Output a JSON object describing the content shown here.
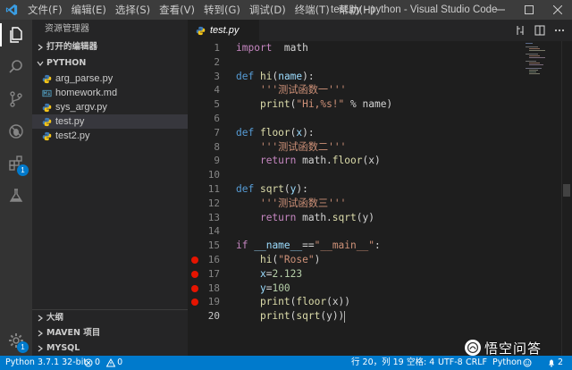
{
  "window": {
    "title": "test.py - python - Visual Studio Code",
    "menu": [
      "文件(F)",
      "编辑(E)",
      "选择(S)",
      "查看(V)",
      "转到(G)",
      "调试(D)",
      "终端(T)",
      "帮助(H)"
    ]
  },
  "activity_bar": {
    "items": [
      {
        "name": "explorer",
        "icon": "files-icon"
      },
      {
        "name": "search",
        "icon": "search-icon"
      },
      {
        "name": "source-control",
        "icon": "source-control-icon"
      },
      {
        "name": "debug",
        "icon": "debug-icon"
      },
      {
        "name": "extensions",
        "icon": "extensions-icon",
        "badge": "1"
      },
      {
        "name": "test",
        "icon": "flask-icon"
      }
    ],
    "settings_badge": "1"
  },
  "sidebar": {
    "title": "资源管理器",
    "open_editors_label": "打开的编辑器",
    "folder_label": "PYTHON",
    "files": [
      {
        "name": "arg_parse.py",
        "type": "python"
      },
      {
        "name": "homework.md",
        "type": "markdown"
      },
      {
        "name": "sys_argv.py",
        "type": "python"
      },
      {
        "name": "test.py",
        "type": "python"
      },
      {
        "name": "test2.py",
        "type": "python"
      }
    ],
    "active_file": "test.py",
    "bottom_sections": [
      "大纲",
      "MAVEN 项目",
      "MYSQL"
    ]
  },
  "editor": {
    "tab_label": "test.py",
    "lines": [
      {
        "n": "1",
        "tokens": [
          [
            "kw2",
            "import"
          ],
          [
            "",
            "  math"
          ]
        ]
      },
      {
        "n": "2",
        "tokens": []
      },
      {
        "n": "3",
        "tokens": [
          [
            "kw",
            "def"
          ],
          [
            "",
            " "
          ],
          [
            "fn",
            "hi"
          ],
          [
            "",
            "("
          ],
          [
            "var",
            "name"
          ],
          [
            "",
            "):"
          ]
        ]
      },
      {
        "n": "4",
        "indent": true,
        "tokens": [
          [
            "str",
            "'''测试函数一'''"
          ]
        ]
      },
      {
        "n": "5",
        "indent": true,
        "tokens": [
          [
            "fn",
            "print"
          ],
          [
            "",
            "("
          ],
          [
            "str",
            "\"Hi,%s!\""
          ],
          [
            "",
            " % name)"
          ]
        ]
      },
      {
        "n": "6",
        "tokens": []
      },
      {
        "n": "7",
        "tokens": [
          [
            "kw",
            "def"
          ],
          [
            "",
            " "
          ],
          [
            "fn",
            "floor"
          ],
          [
            "",
            "("
          ],
          [
            "var",
            "x"
          ],
          [
            "",
            "):"
          ]
        ]
      },
      {
        "n": "8",
        "indent": true,
        "tokens": [
          [
            "str",
            "'''测试函数二'''"
          ]
        ]
      },
      {
        "n": "9",
        "indent": true,
        "tokens": [
          [
            "kw2",
            "return"
          ],
          [
            "",
            " math."
          ],
          [
            "fn",
            "floor"
          ],
          [
            "",
            "(x)"
          ]
        ]
      },
      {
        "n": "10",
        "tokens": []
      },
      {
        "n": "11",
        "tokens": [
          [
            "kw",
            "def"
          ],
          [
            "",
            " "
          ],
          [
            "fn",
            "sqrt"
          ],
          [
            "",
            "("
          ],
          [
            "var",
            "y"
          ],
          [
            "",
            "):"
          ]
        ]
      },
      {
        "n": "12",
        "indent": true,
        "tokens": [
          [
            "str",
            "'''测试函数三'''"
          ]
        ]
      },
      {
        "n": "13",
        "indent": true,
        "tokens": [
          [
            "kw2",
            "return"
          ],
          [
            "",
            " math."
          ],
          [
            "fn",
            "sqrt"
          ],
          [
            "",
            "(y)"
          ]
        ]
      },
      {
        "n": "14",
        "tokens": []
      },
      {
        "n": "15",
        "tokens": [
          [
            "kw2",
            "if"
          ],
          [
            "",
            " "
          ],
          [
            "var",
            "__name__"
          ],
          [
            "",
            "=="
          ],
          [
            "str",
            "\"__main__\""
          ],
          [
            "",
            ":"
          ]
        ]
      },
      {
        "n": "16",
        "bp": true,
        "indent": true,
        "tokens": [
          [
            "fn",
            "hi"
          ],
          [
            "",
            "("
          ],
          [
            "str",
            "\"Rose\""
          ],
          [
            "",
            ")"
          ]
        ]
      },
      {
        "n": "17",
        "bp": true,
        "indent": true,
        "tokens": [
          [
            "var",
            "x"
          ],
          [
            "",
            "="
          ],
          [
            "num",
            "2.123"
          ]
        ]
      },
      {
        "n": "18",
        "bp": true,
        "indent": true,
        "tokens": [
          [
            "var",
            "y"
          ],
          [
            "",
            "="
          ],
          [
            "num",
            "100"
          ]
        ]
      },
      {
        "n": "19",
        "bp": true,
        "indent": true,
        "tokens": [
          [
            "fn",
            "print"
          ],
          [
            "",
            "("
          ],
          [
            "fn",
            "floor"
          ],
          [
            "",
            "(x))"
          ]
        ]
      },
      {
        "n": "20",
        "current": true,
        "indent": true,
        "tokens": [
          [
            "fn",
            "print"
          ],
          [
            "",
            "("
          ],
          [
            "fn",
            "sqrt"
          ],
          [
            "",
            "(y))"
          ]
        ]
      }
    ]
  },
  "status_bar": {
    "interpreter": "Python 3.7.1 32-bit",
    "errors": "0",
    "warnings": "0",
    "position": "行 20，列 19",
    "spaces": "空格: 4",
    "encoding": "UTF-8",
    "eol": "CRLF",
    "language": "Python",
    "notifications": "2"
  },
  "watermark": {
    "text": "悟空问答"
  }
}
